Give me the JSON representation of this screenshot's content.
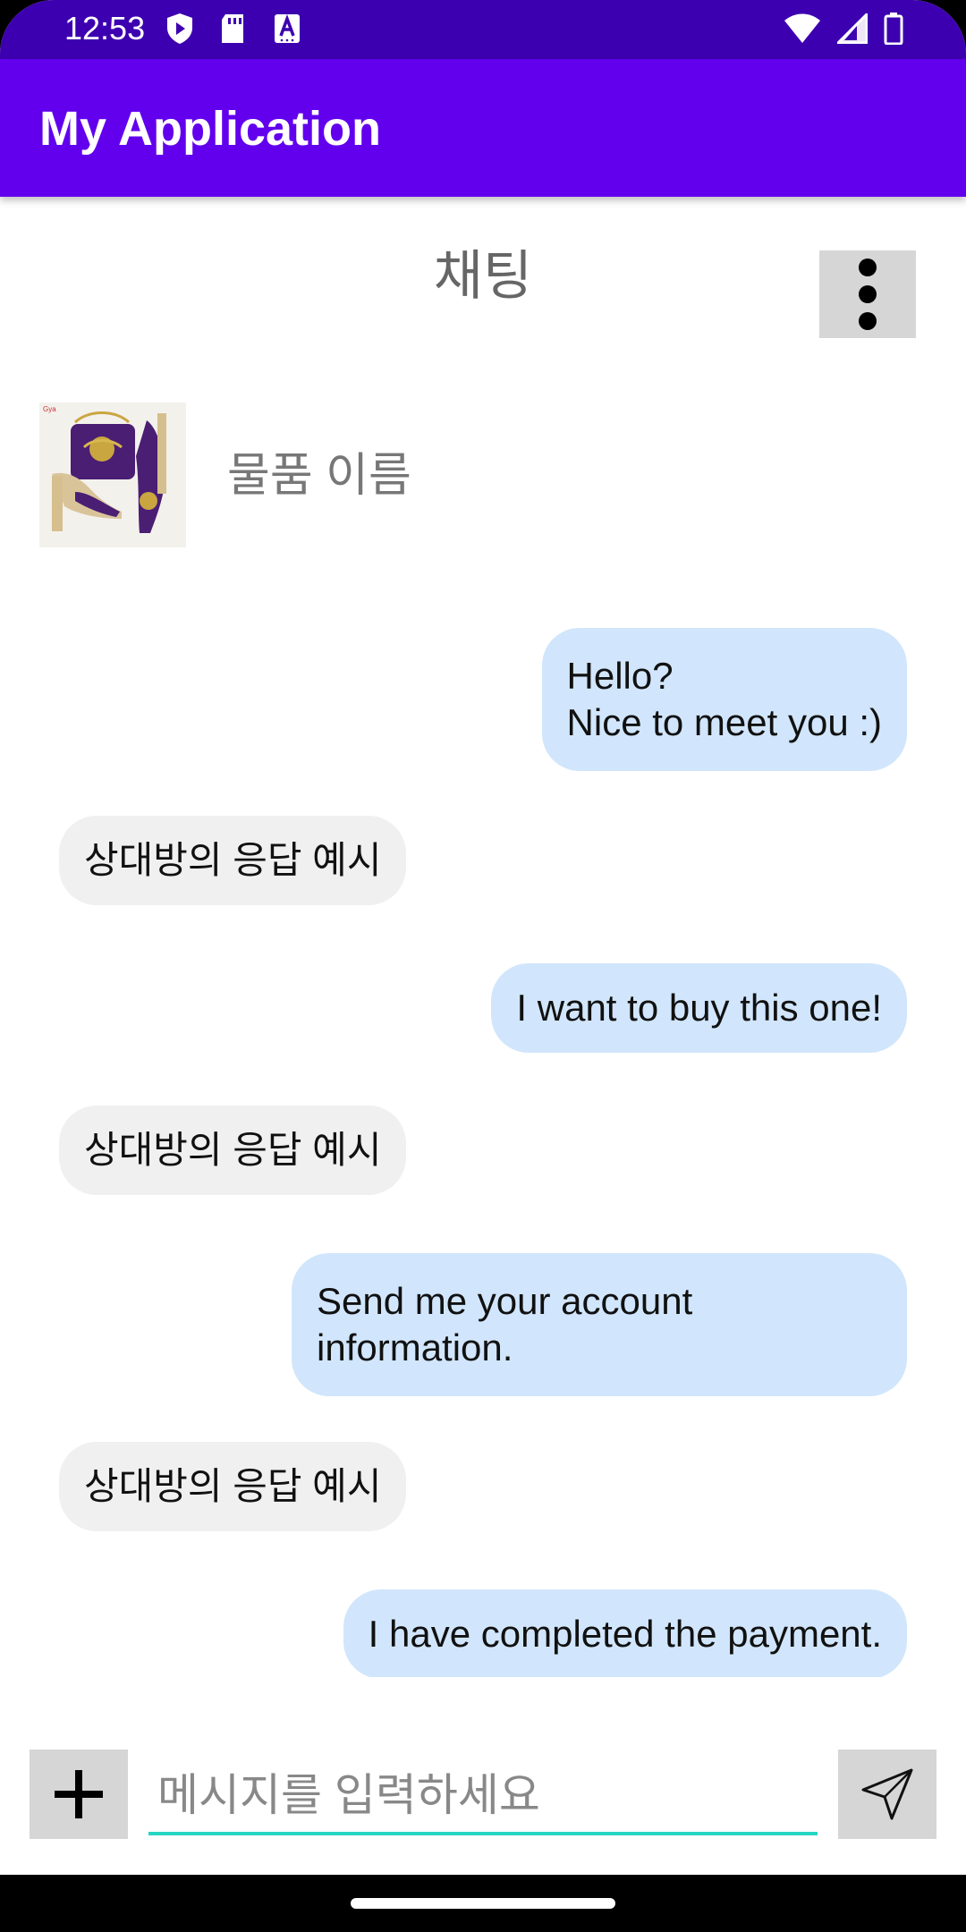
{
  "status_bar": {
    "time": "12:53",
    "left_icons": [
      "shield-play-icon",
      "sd-card-icon",
      "a-keyboard-icon"
    ],
    "right_icons": [
      "wifi-icon",
      "signal-icon",
      "battery-icon"
    ]
  },
  "app_bar": {
    "title": "My Application",
    "color": "#6200ee"
  },
  "header": {
    "title": "채팅",
    "more_icon": "more-vertical-icon"
  },
  "product": {
    "name": "물품 이름"
  },
  "messages": [
    {
      "side": "mine",
      "text": "Hello?\nNice to meet you :)"
    },
    {
      "side": "theirs",
      "text": "상대방의 응답 예시"
    },
    {
      "side": "mine",
      "text": "I want to buy this one!"
    },
    {
      "side": "theirs",
      "text": "상대방의 응답 예시"
    },
    {
      "side": "mine",
      "text": "Send me your account\ninformation."
    },
    {
      "side": "theirs",
      "text": "상대방의 응답 예시"
    },
    {
      "side": "mine",
      "text": "I have completed the payment."
    }
  ],
  "input_bar": {
    "add_icon": "plus-icon",
    "placeholder": "메시지를 입력하세요",
    "value": "",
    "send_icon": "send-icon",
    "accent": "#26d6c2"
  },
  "colors": {
    "my_bubble": "#d1e6fc",
    "their_bubble": "#f0f0f0",
    "status_bar": "#3d00b0"
  }
}
